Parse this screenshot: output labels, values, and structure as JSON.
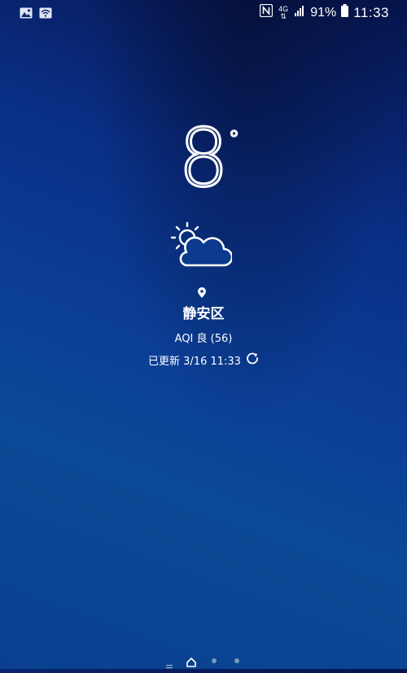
{
  "status_bar": {
    "network_type": "4G",
    "battery_percent": "91%",
    "time": "11:33",
    "icons": [
      "image-notification-icon",
      "wifi-notification-icon",
      "nfc-icon",
      "data-arrows-icon",
      "signal-icon",
      "battery-icon"
    ]
  },
  "weather": {
    "temperature": "8",
    "degree_symbol": "°",
    "condition_icon": "partly-cloudy-icon",
    "location_icon": "location-pin-icon",
    "location": "静安区",
    "aqi": "AQI 良 (56)",
    "updated_text": "已更新 3/16 11:33",
    "refresh_icon": "refresh-icon"
  },
  "page_indicator": {
    "pages": [
      "menu",
      "home",
      "page-2",
      "page-3"
    ],
    "active": "home"
  },
  "colors": {
    "background_top": "#06134a",
    "background_mid": "#0a2f86",
    "background_bottom": "#0b4a96",
    "text": "#ffffff"
  }
}
